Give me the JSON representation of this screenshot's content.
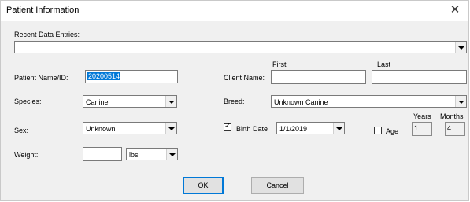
{
  "window": {
    "title": "Patient Information",
    "close_icon": "close-icon"
  },
  "recent": {
    "label": "Recent Data Entries:",
    "value": ""
  },
  "patient": {
    "label": "Patient Name/ID:",
    "value": "20200514"
  },
  "client": {
    "label": "Client Name:",
    "first_header": "First",
    "last_header": "Last",
    "first_value": "",
    "last_value": ""
  },
  "species": {
    "label": "Species:",
    "value": "Canine"
  },
  "breed": {
    "label": "Breed:",
    "value": "Unknown Canine"
  },
  "sex": {
    "label": "Sex:",
    "value": "Unknown"
  },
  "birth": {
    "checked": true,
    "label": "Birth Date",
    "value": "1/1/2019"
  },
  "age": {
    "checked": false,
    "label": "Age",
    "years_header": "Years",
    "months_header": "Months",
    "years": "1",
    "months": "4"
  },
  "weight": {
    "label": "Weight:",
    "value": "",
    "unit": "lbs"
  },
  "buttons": {
    "ok": "OK",
    "cancel": "Cancel"
  },
  "colors": {
    "selection": "#0078d7",
    "dialog_bg": "#f0f0f0"
  }
}
